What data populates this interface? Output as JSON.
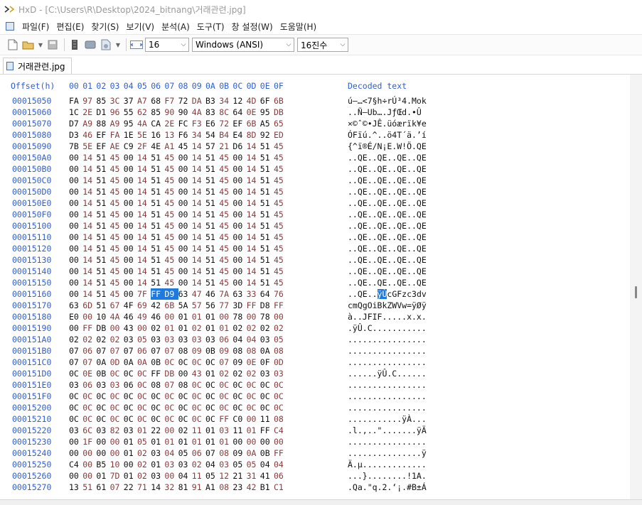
{
  "window": {
    "title": "HxD - [C:\\Users\\R\\Desktop\\2024_bitnang\\거래관련.jpg]"
  },
  "menu": {
    "items": [
      "파일(F)",
      "편집(E)",
      "찾기(S)",
      "보기(V)",
      "분석(A)",
      "도구(T)",
      "창 설정(W)",
      "도움말(H)"
    ]
  },
  "toolbar": {
    "bytes_per_row": "16",
    "charset": "Windows (ANSI)",
    "offset_base": "16진수",
    "icons": [
      "new-file-icon",
      "open-folder-icon",
      "save-icon",
      "ram-icon",
      "disk-icon",
      "disk-image-icon",
      "columns-icon"
    ]
  },
  "tab": {
    "label": "거래관련.jpg"
  },
  "hex": {
    "offset_header": "Offset(h)",
    "columns": [
      "00",
      "01",
      "02",
      "03",
      "04",
      "05",
      "06",
      "07",
      "08",
      "09",
      "0A",
      "0B",
      "0C",
      "0D",
      "0E",
      "0F"
    ],
    "decoded_header": "Decoded text",
    "rows": [
      {
        "offset": "00015050",
        "bytes": [
          "FA",
          "97",
          "85",
          "3C",
          "37",
          "A7",
          "68",
          "F7",
          "72",
          "DA",
          "B3",
          "34",
          "12",
          "4D",
          "6F",
          "6B"
        ],
        "text": "ú—…<7§h÷rÚ³4.Mok"
      },
      {
        "offset": "00015060",
        "bytes": [
          "1C",
          "2E",
          "D1",
          "96",
          "55",
          "62",
          "85",
          "90",
          "90",
          "4A",
          "83",
          "8C",
          "64",
          "0E",
          "95",
          "DB"
        ],
        "text": "..Ñ–Ub….JƒŒd.•Û"
      },
      {
        "offset": "00015070",
        "bytes": [
          "D7",
          "A9",
          "88",
          "A9",
          "95",
          "4A",
          "CA",
          "2E",
          "FC",
          "F3",
          "E6",
          "72",
          "EF",
          "6B",
          "A5",
          "65"
        ],
        "text": "×©ˆ©•JÊ.üóærïk¥e"
      },
      {
        "offset": "00015080",
        "bytes": [
          "D3",
          "46",
          "EF",
          "FA",
          "1E",
          "5E",
          "16",
          "13",
          "F6",
          "34",
          "54",
          "B4",
          "E4",
          "8D",
          "92",
          "ED"
        ],
        "text": "ÓFïú.^..ö4T´ä.’í"
      },
      {
        "offset": "00015090",
        "bytes": [
          "7B",
          "5E",
          "EF",
          "AE",
          "C9",
          "2F",
          "4E",
          "A1",
          "45",
          "14",
          "57",
          "21",
          "D6",
          "14",
          "51",
          "45"
        ],
        "text": "{^ï®É/N¡E.W!Ö.QE"
      },
      {
        "offset": "000150A0",
        "bytes": [
          "00",
          "14",
          "51",
          "45",
          "00",
          "14",
          "51",
          "45",
          "00",
          "14",
          "51",
          "45",
          "00",
          "14",
          "51",
          "45"
        ],
        "text": "..QE..QE..QE..QE"
      },
      {
        "offset": "000150B0",
        "bytes": [
          "00",
          "14",
          "51",
          "45",
          "00",
          "14",
          "51",
          "45",
          "00",
          "14",
          "51",
          "45",
          "00",
          "14",
          "51",
          "45"
        ],
        "text": "..QE..QE..QE..QE"
      },
      {
        "offset": "000150C0",
        "bytes": [
          "00",
          "14",
          "51",
          "45",
          "00",
          "14",
          "51",
          "45",
          "00",
          "14",
          "51",
          "45",
          "00",
          "14",
          "51",
          "45"
        ],
        "text": "..QE..QE..QE..QE"
      },
      {
        "offset": "000150D0",
        "bytes": [
          "00",
          "14",
          "51",
          "45",
          "00",
          "14",
          "51",
          "45",
          "00",
          "14",
          "51",
          "45",
          "00",
          "14",
          "51",
          "45"
        ],
        "text": "..QE..QE..QE..QE"
      },
      {
        "offset": "000150E0",
        "bytes": [
          "00",
          "14",
          "51",
          "45",
          "00",
          "14",
          "51",
          "45",
          "00",
          "14",
          "51",
          "45",
          "00",
          "14",
          "51",
          "45"
        ],
        "text": "..QE..QE..QE..QE"
      },
      {
        "offset": "000150F0",
        "bytes": [
          "00",
          "14",
          "51",
          "45",
          "00",
          "14",
          "51",
          "45",
          "00",
          "14",
          "51",
          "45",
          "00",
          "14",
          "51",
          "45"
        ],
        "text": "..QE..QE..QE..QE"
      },
      {
        "offset": "00015100",
        "bytes": [
          "00",
          "14",
          "51",
          "45",
          "00",
          "14",
          "51",
          "45",
          "00",
          "14",
          "51",
          "45",
          "00",
          "14",
          "51",
          "45"
        ],
        "text": "..QE..QE..QE..QE"
      },
      {
        "offset": "00015110",
        "bytes": [
          "00",
          "14",
          "51",
          "45",
          "00",
          "14",
          "51",
          "45",
          "00",
          "14",
          "51",
          "45",
          "00",
          "14",
          "51",
          "45"
        ],
        "text": "..QE..QE..QE..QE"
      },
      {
        "offset": "00015120",
        "bytes": [
          "00",
          "14",
          "51",
          "45",
          "00",
          "14",
          "51",
          "45",
          "00",
          "14",
          "51",
          "45",
          "00",
          "14",
          "51",
          "45"
        ],
        "text": "..QE..QE..QE..QE"
      },
      {
        "offset": "00015130",
        "bytes": [
          "00",
          "14",
          "51",
          "45",
          "00",
          "14",
          "51",
          "45",
          "00",
          "14",
          "51",
          "45",
          "00",
          "14",
          "51",
          "45"
        ],
        "text": "..QE..QE..QE..QE"
      },
      {
        "offset": "00015140",
        "bytes": [
          "00",
          "14",
          "51",
          "45",
          "00",
          "14",
          "51",
          "45",
          "00",
          "14",
          "51",
          "45",
          "00",
          "14",
          "51",
          "45"
        ],
        "text": "..QE..QE..QE..QE"
      },
      {
        "offset": "00015150",
        "bytes": [
          "00",
          "14",
          "51",
          "45",
          "00",
          "14",
          "51",
          "45",
          "00",
          "14",
          "51",
          "45",
          "00",
          "14",
          "51",
          "45"
        ],
        "text": "..QE..QE..QE..QE"
      },
      {
        "offset": "00015160",
        "bytes": [
          "00",
          "14",
          "51",
          "45",
          "00",
          "7F",
          "FF",
          "D9",
          "63",
          "47",
          "46",
          "7A",
          "63",
          "33",
          "64",
          "76"
        ],
        "text": "..QE..ÿÙcGFzc3dv",
        "selected": [
          6,
          7
        ],
        "text_sel_start": 6,
        "text_sel_len": 2
      },
      {
        "offset": "00015170",
        "bytes": [
          "63",
          "6D",
          "51",
          "67",
          "4F",
          "69",
          "42",
          "6B",
          "5A",
          "57",
          "56",
          "77",
          "3D",
          "FF",
          "D8",
          "FF"
        ],
        "text": "cmQgOiBkZWVw=ÿØÿ"
      },
      {
        "offset": "00015180",
        "bytes": [
          "E0",
          "00",
          "10",
          "4A",
          "46",
          "49",
          "46",
          "00",
          "01",
          "01",
          "01",
          "00",
          "78",
          "00",
          "78",
          "00"
        ],
        "text": "à..JFIF.....x.x."
      },
      {
        "offset": "00015190",
        "bytes": [
          "00",
          "FF",
          "DB",
          "00",
          "43",
          "00",
          "02",
          "01",
          "01",
          "02",
          "01",
          "01",
          "02",
          "02",
          "02",
          "02"
        ],
        "text": ".ÿÛ.C..........."
      },
      {
        "offset": "000151A0",
        "bytes": [
          "02",
          "02",
          "02",
          "02",
          "03",
          "05",
          "03",
          "03",
          "03",
          "03",
          "03",
          "06",
          "04",
          "04",
          "03",
          "05"
        ],
        "text": "................"
      },
      {
        "offset": "000151B0",
        "bytes": [
          "07",
          "06",
          "07",
          "07",
          "07",
          "06",
          "07",
          "07",
          "08",
          "09",
          "0B",
          "09",
          "08",
          "08",
          "0A",
          "08"
        ],
        "text": "................"
      },
      {
        "offset": "000151C0",
        "bytes": [
          "07",
          "07",
          "0A",
          "0D",
          "0A",
          "0A",
          "0B",
          "0C",
          "0C",
          "0C",
          "0C",
          "07",
          "09",
          "0E",
          "0F",
          "0D"
        ],
        "text": "................"
      },
      {
        "offset": "000151D0",
        "bytes": [
          "0C",
          "0E",
          "0B",
          "0C",
          "0C",
          "0C",
          "FF",
          "DB",
          "00",
          "43",
          "01",
          "02",
          "02",
          "02",
          "03",
          "03"
        ],
        "text": "......ÿÛ.C......"
      },
      {
        "offset": "000151E0",
        "bytes": [
          "03",
          "06",
          "03",
          "03",
          "06",
          "0C",
          "08",
          "07",
          "08",
          "0C",
          "0C",
          "0C",
          "0C",
          "0C",
          "0C",
          "0C"
        ],
        "text": "................"
      },
      {
        "offset": "000151F0",
        "bytes": [
          "0C",
          "0C",
          "0C",
          "0C",
          "0C",
          "0C",
          "0C",
          "0C",
          "0C",
          "0C",
          "0C",
          "0C",
          "0C",
          "0C",
          "0C",
          "0C"
        ],
        "text": "................"
      },
      {
        "offset": "00015200",
        "bytes": [
          "0C",
          "0C",
          "0C",
          "0C",
          "0C",
          "0C",
          "0C",
          "0C",
          "0C",
          "0C",
          "0C",
          "0C",
          "0C",
          "0C",
          "0C",
          "0C"
        ],
        "text": "................"
      },
      {
        "offset": "00015210",
        "bytes": [
          "0C",
          "0C",
          "0C",
          "0C",
          "0C",
          "0C",
          "0C",
          "0C",
          "0C",
          "0C",
          "0C",
          "FF",
          "C0",
          "00",
          "11",
          "08"
        ],
        "text": "...........ÿÀ..."
      },
      {
        "offset": "00015220",
        "bytes": [
          "03",
          "6C",
          "03",
          "82",
          "03",
          "01",
          "22",
          "00",
          "02",
          "11",
          "01",
          "03",
          "11",
          "01",
          "FF",
          "C4"
        ],
        "text": ".l.‚..\".......ÿÄ"
      },
      {
        "offset": "00015230",
        "bytes": [
          "00",
          "1F",
          "00",
          "00",
          "01",
          "05",
          "01",
          "01",
          "01",
          "01",
          "01",
          "01",
          "00",
          "00",
          "00",
          "00"
        ],
        "text": "................"
      },
      {
        "offset": "00015240",
        "bytes": [
          "00",
          "00",
          "00",
          "00",
          "01",
          "02",
          "03",
          "04",
          "05",
          "06",
          "07",
          "08",
          "09",
          "0A",
          "0B",
          "FF"
        ],
        "text": "...............ÿ"
      },
      {
        "offset": "00015250",
        "bytes": [
          "C4",
          "00",
          "B5",
          "10",
          "00",
          "02",
          "01",
          "03",
          "03",
          "02",
          "04",
          "03",
          "05",
          "05",
          "04",
          "04"
        ],
        "text": "Ä.µ............."
      },
      {
        "offset": "00015260",
        "bytes": [
          "00",
          "00",
          "01",
          "7D",
          "01",
          "02",
          "03",
          "00",
          "04",
          "11",
          "05",
          "12",
          "21",
          "31",
          "41",
          "06"
        ],
        "text": "...}........!1A."
      },
      {
        "offset": "00015270",
        "bytes": [
          "13",
          "51",
          "61",
          "07",
          "22",
          "71",
          "14",
          "32",
          "81",
          "91",
          "A1",
          "08",
          "23",
          "42",
          "B1",
          "C1"
        ],
        "text": ".Qa.\"q.2.‘¡.#B±Á"
      }
    ]
  }
}
